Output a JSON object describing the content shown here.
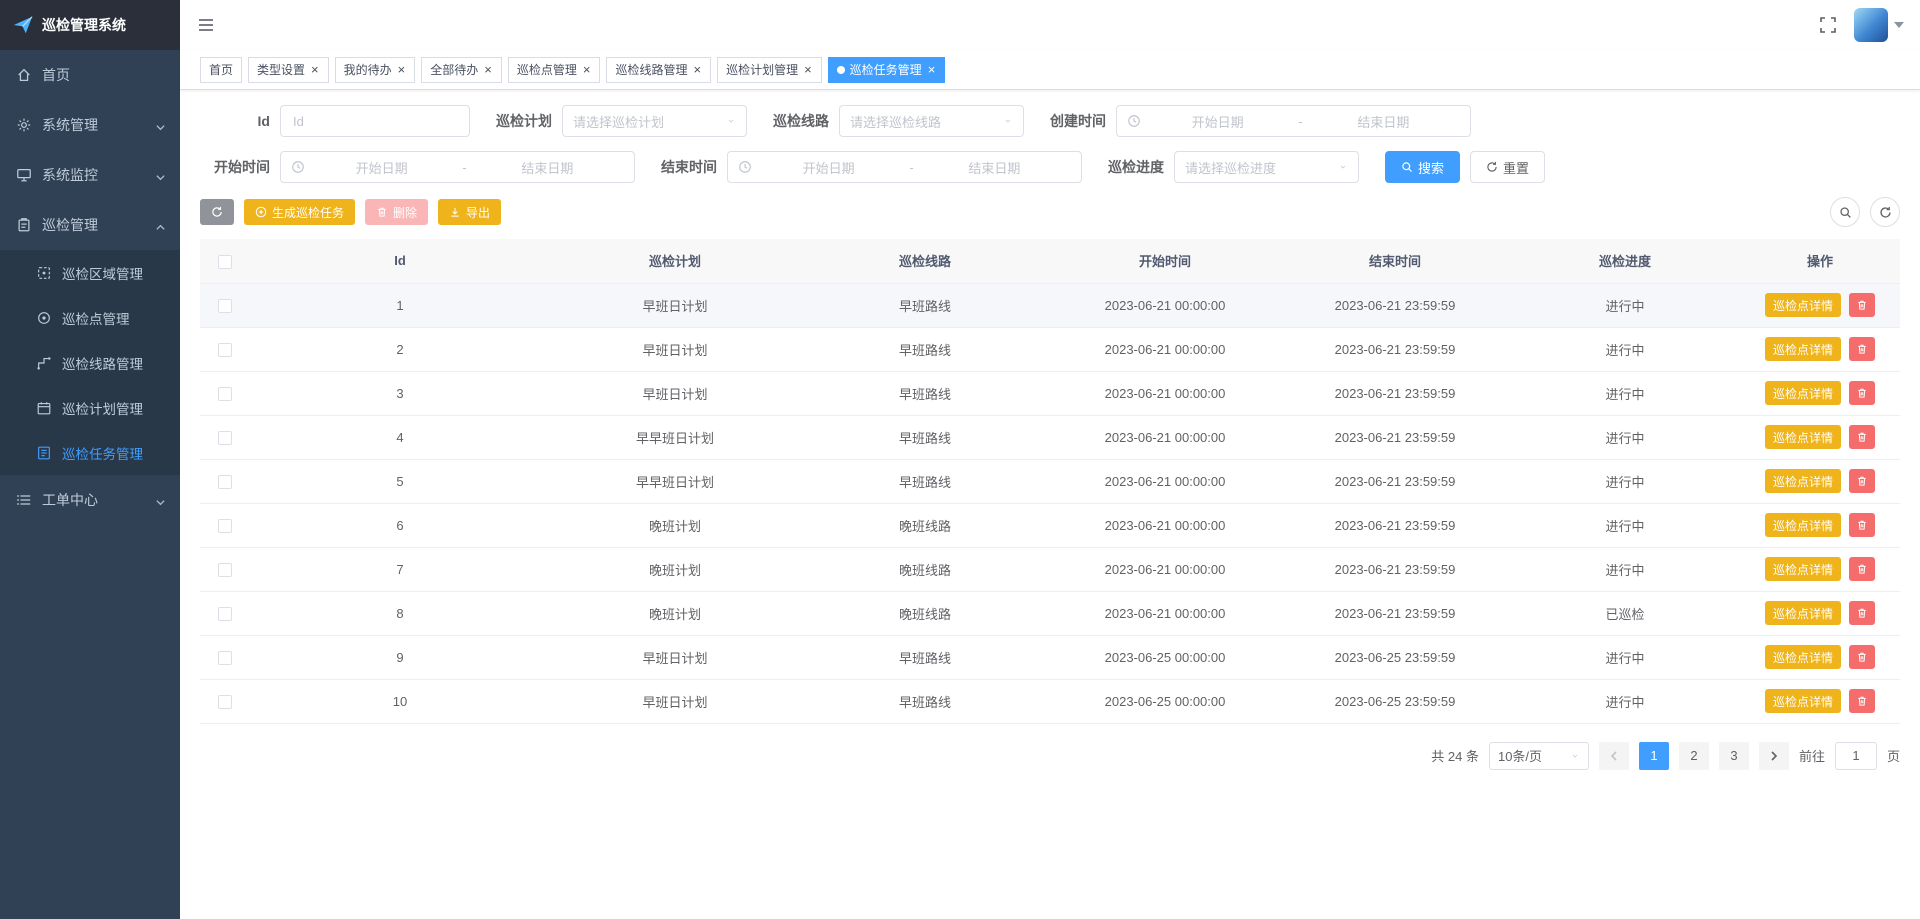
{
  "colors": {
    "primary": "#409EFF",
    "warning": "#EFB41B",
    "danger": "#F56C6C",
    "danger_disabled": "#FAB6B6",
    "sidebar_bg": "#304156",
    "sidebar_text": "#BFCBD9"
  },
  "app": {
    "title": "巡检管理系统"
  },
  "sidebar": {
    "items": [
      {
        "label": "首页"
      },
      {
        "label": "系统管理"
      },
      {
        "label": "系统监控"
      },
      {
        "label": "巡检管理",
        "children": [
          {
            "label": "巡检区域管理"
          },
          {
            "label": "巡检点管理"
          },
          {
            "label": "巡检线路管理"
          },
          {
            "label": "巡检计划管理"
          },
          {
            "label": "巡检任务管理",
            "active": true
          }
        ]
      },
      {
        "label": "工单中心"
      }
    ]
  },
  "tabs": [
    {
      "label": "首页",
      "closable": false,
      "active": false
    },
    {
      "label": "类型设置",
      "closable": true,
      "active": false
    },
    {
      "label": "我的待办",
      "closable": true,
      "active": false
    },
    {
      "label": "全部待办",
      "closable": true,
      "active": false
    },
    {
      "label": "巡检点管理",
      "closable": true,
      "active": false
    },
    {
      "label": "巡检线路管理",
      "closable": true,
      "active": false
    },
    {
      "label": "巡检计划管理",
      "closable": true,
      "active": false
    },
    {
      "label": "巡检任务管理",
      "closable": true,
      "active": true
    }
  ],
  "filters": {
    "id_label": "Id",
    "id_placeholder": "Id",
    "id_value": "",
    "plan_label": "巡检计划",
    "plan_placeholder": "请选择巡检计划",
    "route_label": "巡检线路",
    "route_placeholder": "请选择巡检线路",
    "create_label": "创建时间",
    "start_label": "开始时间",
    "end_label": "结束时间",
    "progress_label": "巡检进度",
    "progress_placeholder": "请选择巡检进度",
    "range_start_placeholder": "开始日期",
    "range_end_placeholder": "结束日期",
    "range_separator": "-",
    "search_label": "搜索",
    "reset_label": "重置"
  },
  "toolbar": {
    "generate_label": "生成巡检任务",
    "delete_label": "删除",
    "export_label": "导出"
  },
  "table": {
    "columns": [
      "Id",
      "巡检计划",
      "巡检线路",
      "开始时间",
      "结束时间",
      "巡检进度",
      "操作"
    ],
    "detail_button_label": "巡检点详情",
    "rows": [
      {
        "id": "1",
        "plan": "早班日计划",
        "route": "早班路线",
        "start": "2023-06-21 00:00:00",
        "end": "2023-06-21 23:59:59",
        "progress": "进行中",
        "highlighted": true
      },
      {
        "id": "2",
        "plan": "早班日计划",
        "route": "早班路线",
        "start": "2023-06-21 00:00:00",
        "end": "2023-06-21 23:59:59",
        "progress": "进行中"
      },
      {
        "id": "3",
        "plan": "早班日计划",
        "route": "早班路线",
        "start": "2023-06-21 00:00:00",
        "end": "2023-06-21 23:59:59",
        "progress": "进行中"
      },
      {
        "id": "4",
        "plan": "早早班日计划",
        "route": "早班路线",
        "start": "2023-06-21 00:00:00",
        "end": "2023-06-21 23:59:59",
        "progress": "进行中"
      },
      {
        "id": "5",
        "plan": "早早班日计划",
        "route": "早班路线",
        "start": "2023-06-21 00:00:00",
        "end": "2023-06-21 23:59:59",
        "progress": "进行中"
      },
      {
        "id": "6",
        "plan": "晚班计划",
        "route": "晚班线路",
        "start": "2023-06-21 00:00:00",
        "end": "2023-06-21 23:59:59",
        "progress": "进行中"
      },
      {
        "id": "7",
        "plan": "晚班计划",
        "route": "晚班线路",
        "start": "2023-06-21 00:00:00",
        "end": "2023-06-21 23:59:59",
        "progress": "进行中"
      },
      {
        "id": "8",
        "plan": "晚班计划",
        "route": "晚班线路",
        "start": "2023-06-21 00:00:00",
        "end": "2023-06-21 23:59:59",
        "progress": "已巡检"
      },
      {
        "id": "9",
        "plan": "早班日计划",
        "route": "早班路线",
        "start": "2023-06-25 00:00:00",
        "end": "2023-06-25 23:59:59",
        "progress": "进行中"
      },
      {
        "id": "10",
        "plan": "早班日计划",
        "route": "早班路线",
        "start": "2023-06-25 00:00:00",
        "end": "2023-06-25 23:59:59",
        "progress": "进行中"
      }
    ]
  },
  "pagination": {
    "total_text": "共 24 条",
    "page_size_label": "10条/页",
    "pages": [
      "1",
      "2",
      "3"
    ],
    "active_page": "1",
    "goto_prefix": "前往",
    "goto_value": "1",
    "goto_suffix": "页"
  }
}
